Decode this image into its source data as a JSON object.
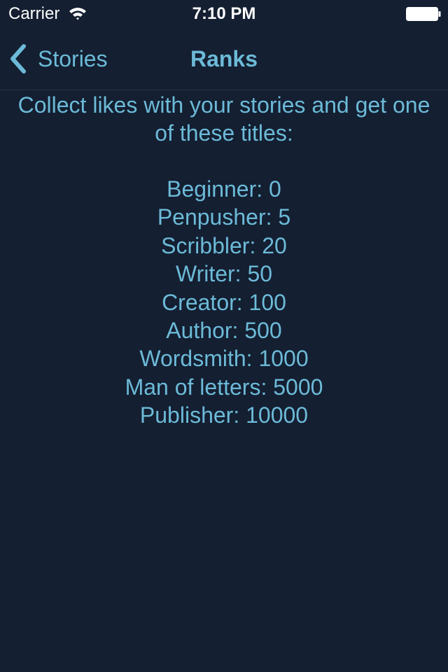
{
  "status_bar": {
    "carrier": "Carrier",
    "time": "7:10 PM",
    "icons": [
      "wifi-icon",
      "battery-icon"
    ]
  },
  "nav": {
    "back_label": "Stories",
    "back_icon": "chevron-left-icon",
    "title": "Ranks"
  },
  "content": {
    "intro": "Collect likes with your stories and get one of these titles:",
    "ranks": [
      "Beginner: 0",
      "Penpusher: 5",
      "Scribbler: 20",
      "Writer: 50",
      "Creator: 100",
      "Author: 500",
      "Wordsmith: 1000",
      "Man of letters: 5000",
      "Publisher: 10000"
    ]
  },
  "colors": {
    "background": "#141f31",
    "accent": "#6cbad8",
    "status_text": "#ffffff"
  }
}
